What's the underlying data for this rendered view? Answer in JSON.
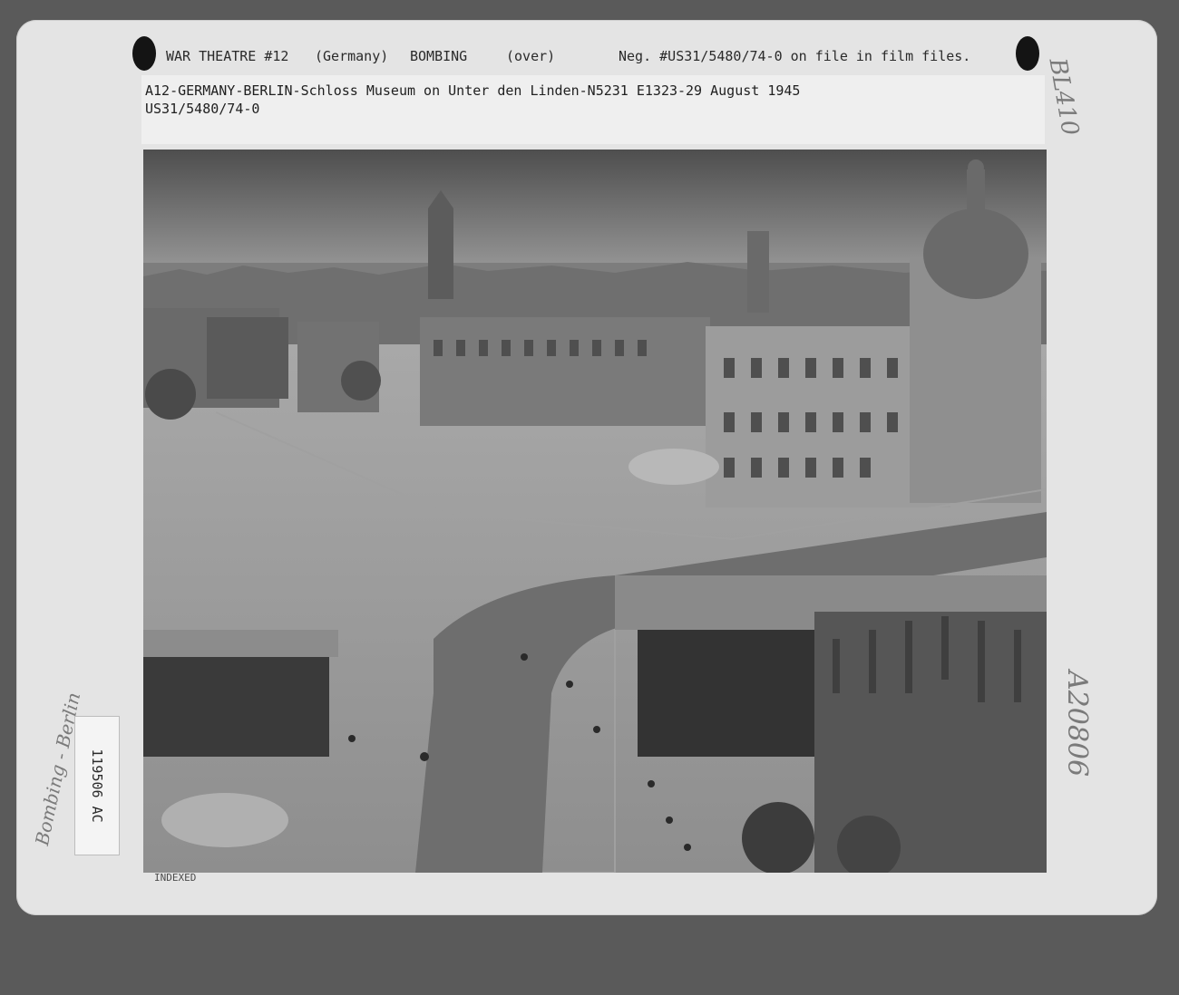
{
  "header": {
    "theatre": "WAR THEATRE #12",
    "country": "(Germany)",
    "subject": "BOMBING",
    "over": "(over)",
    "negative": "Neg. #US31/5480/74-0 on file in film files."
  },
  "caption": {
    "line1": "A12-GERMANY-BERLIN-Schloss Museum on Unter den Linden-N5231 E1323-29 August 1945",
    "line2": "US31/5480/74-0"
  },
  "annotations": {
    "top_right": "BL410",
    "right_side": "A20806",
    "left_side": "Bombing - Berlin",
    "label_number": "119506 AC",
    "stamp": "INDEXED"
  },
  "photo": {
    "description_icon": "aerial-city-photo-icon"
  },
  "colors": {
    "card": "#e4e4e4",
    "background": "#5a5a5a"
  }
}
